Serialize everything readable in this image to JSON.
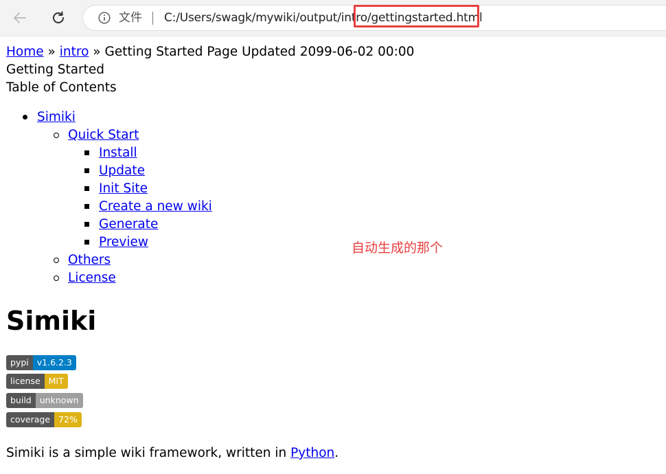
{
  "browser": {
    "file_label": "文件",
    "url": "C:/Users/swagk/mywiki/output/intro/gettingstarted.html"
  },
  "breadcrumb": {
    "home": "Home",
    "sep1": "»",
    "intro": "intro",
    "sep2": "»",
    "page": "Getting Started Page Updated",
    "date": "2099-06-02 00:00"
  },
  "page": {
    "subtitle": "Getting Started",
    "toc_title": "Table of Contents"
  },
  "toc": {
    "simiki": "Simiki",
    "quick_start": "Quick Start",
    "install": "Install",
    "update": "Update",
    "init_site": "Init Site",
    "create_wiki": "Create a new wiki",
    "generate": "Generate",
    "preview": "Preview",
    "others": "Others",
    "license": "License"
  },
  "annotation": "自动生成的那个",
  "heading": "Simiki",
  "badges": [
    {
      "label": "pypi",
      "value": "v1.6.2.3",
      "color": "#007ec6"
    },
    {
      "label": "license",
      "value": "MIT",
      "color": "#dfb317"
    },
    {
      "label": "build",
      "value": "unknown",
      "color": "#9f9f9f"
    },
    {
      "label": "coverage",
      "value": "72%",
      "color": "#dfb317"
    }
  ],
  "intro_text": {
    "before": "Simiki is a simple wiki framework, written in ",
    "link": "Python",
    "after": "."
  }
}
